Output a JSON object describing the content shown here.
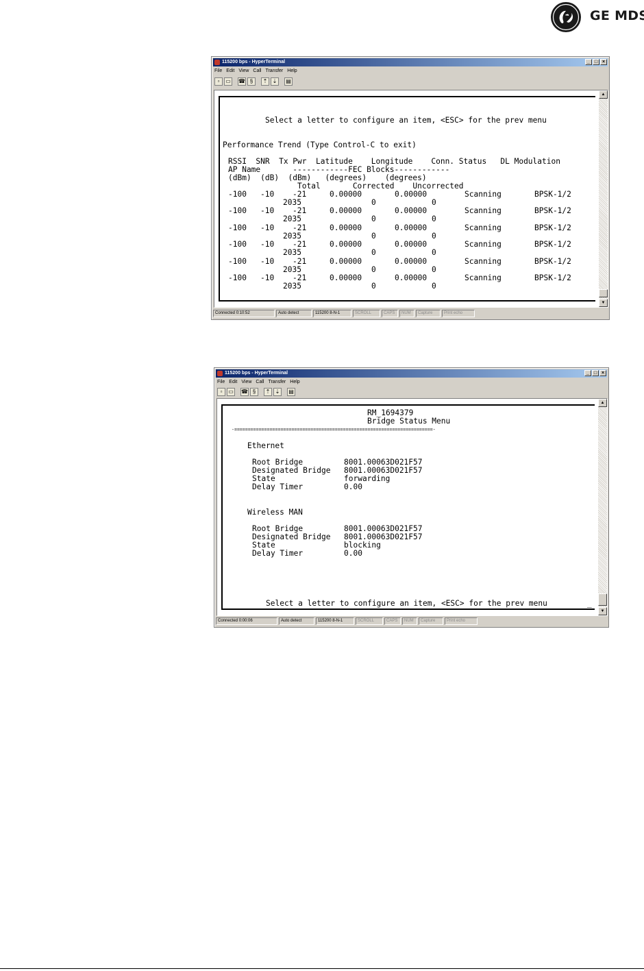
{
  "logo": {
    "text": "GE MDS",
    "mark": "GE"
  },
  "window1": {
    "title": "115200 bps - HyperTerminal",
    "menu": [
      "File",
      "Edit",
      "View",
      "Call",
      "Transfer",
      "Help"
    ],
    "terminal_lines": [
      "Select a letter to configure an item, <ESC> for the prev menu",
      "Performance Trend (Type Control-C to exit)",
      "RSSI  SNR  Tx Pwr  Latitude    Longitude    Conn. Status   DL Modulation",
      "AP Name       ------------FEC Blocks------------",
      "(dBm)  (dB)  (dBm)   (degrees)    (degrees)",
      "Total       Corrected    Uncorrected",
      [
        "-100",
        "-10",
        "-21",
        "0.00000",
        "0.00000",
        "Scanning",
        "BPSK-1/2"
      ],
      [
        "2035",
        "0",
        "0"
      ]
    ],
    "rows": [
      {
        "rssi": "-100",
        "snr": "-10",
        "txpwr": "-21",
        "lat": "0.00000",
        "lon": "0.00000",
        "status": "Scanning",
        "mod": "BPSK-1/2",
        "total": "2035",
        "corr": "0",
        "uncorr": "0"
      },
      {
        "rssi": "-100",
        "snr": "-10",
        "txpwr": "-21",
        "lat": "0.00000",
        "lon": "0.00000",
        "status": "Scanning",
        "mod": "BPSK-1/2",
        "total": "2035",
        "corr": "0",
        "uncorr": "0"
      },
      {
        "rssi": "-100",
        "snr": "-10",
        "txpwr": "-21",
        "lat": "0.00000",
        "lon": "0.00000",
        "status": "Scanning",
        "mod": "BPSK-1/2",
        "total": "2035",
        "corr": "0",
        "uncorr": "0"
      },
      {
        "rssi": "-100",
        "snr": "-10",
        "txpwr": "-21",
        "lat": "0.00000",
        "lon": "0.00000",
        "status": "Scanning",
        "mod": "BPSK-1/2",
        "total": "2035",
        "corr": "0",
        "uncorr": "0"
      },
      {
        "rssi": "-100",
        "snr": "-10",
        "txpwr": "-21",
        "lat": "0.00000",
        "lon": "0.00000",
        "status": "Scanning",
        "mod": "BPSK-1/2",
        "total": "2035",
        "corr": "0",
        "uncorr": "0"
      },
      {
        "rssi": "-100",
        "snr": "-10",
        "txpwr": "-21",
        "lat": "0.00000",
        "lon": "0.00000",
        "status": "Scanning",
        "mod": "BPSK-1/2",
        "total": "2035",
        "corr": "0",
        "uncorr": "0"
      }
    ],
    "status": [
      "Connected 0:10:52",
      "Auto detect",
      "115200 8-N-1",
      "SCROLL",
      "CAPS",
      "NUM",
      "Capture",
      "Print echo"
    ]
  },
  "window2": {
    "title": "115200 bps - HyperTerminal",
    "menu": [
      "File",
      "Edit",
      "View",
      "Call",
      "Transfer",
      "Help"
    ],
    "terminal": {
      "device": "RM_1694379",
      "menu_title": "Bridge Status Menu",
      "divider": "-=========================================================================-",
      "ethernet_heading": "Ethernet",
      "ethernet": [
        {
          "label": "Root Bridge",
          "value": "8001.00063D021F57"
        },
        {
          "label": "Designated Bridge",
          "value": "8001.00063D021F57"
        },
        {
          "label": "State",
          "value": "forwarding"
        },
        {
          "label": "Delay Timer",
          "value": "0.00"
        }
      ],
      "wireless_heading": "Wireless MAN",
      "wireless": [
        {
          "label": "Root Bridge",
          "value": "8001.00063D021F57"
        },
        {
          "label": "Designated Bridge",
          "value": "8001.00063D021F57"
        },
        {
          "label": "State",
          "value": "blocking"
        },
        {
          "label": "Delay Timer",
          "value": "0.00"
        }
      ],
      "prompt": "Select a letter to configure an item, <ESC> for the prev menu",
      "cursor": "_"
    },
    "status": [
      "Connected 0:00:06",
      "Auto detect",
      "115200 8-N-1",
      "SCROLL",
      "CAPS",
      "NUM",
      "Capture",
      "Print echo"
    ]
  },
  "icons": {
    "toolbar": [
      "new-icon",
      "open-icon",
      "phone-icon",
      "disconnect-icon",
      "send-icon",
      "receive-icon",
      "properties-icon"
    ]
  }
}
